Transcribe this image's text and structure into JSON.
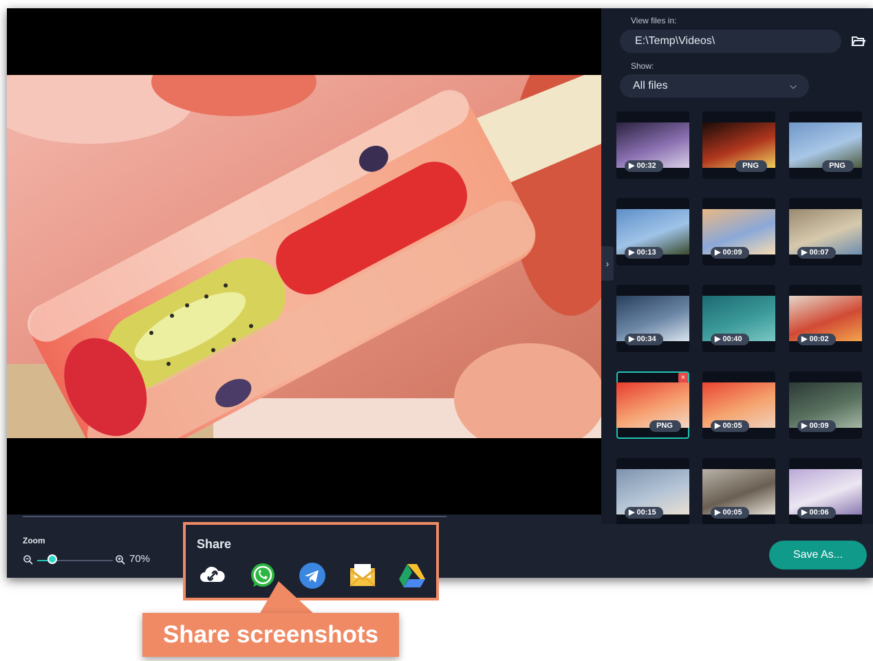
{
  "sidebar": {
    "view_files_label": "View files in:",
    "path_value": "E:\\Temp\\Videos\\",
    "show_label": "Show:",
    "show_selected": "All files",
    "thumbnails": [
      {
        "badge": "▶ 00:32",
        "type": "video"
      },
      {
        "badge": "PNG",
        "type": "image"
      },
      {
        "badge": "PNG",
        "type": "image"
      },
      {
        "badge": "▶ 00:13",
        "type": "video"
      },
      {
        "badge": "▶ 00:09",
        "type": "video"
      },
      {
        "badge": "▶ 00:07",
        "type": "video"
      },
      {
        "badge": "▶ 00:34",
        "type": "video"
      },
      {
        "badge": "▶ 00:40",
        "type": "video"
      },
      {
        "badge": "▶ 00:02",
        "type": "video"
      },
      {
        "badge": "PNG",
        "type": "image",
        "selected": true
      },
      {
        "badge": "▶ 00:05",
        "type": "video"
      },
      {
        "badge": "▶ 00:09",
        "type": "video"
      },
      {
        "badge": "▶ 00:15",
        "type": "video"
      },
      {
        "badge": "▶ 00:05",
        "type": "video"
      },
      {
        "badge": "▶ 00:06",
        "type": "video"
      }
    ]
  },
  "bottom": {
    "zoom_label": "Zoom",
    "zoom_value": "70%",
    "zoom_fraction": 0.2,
    "save_label": "Save As..."
  },
  "share": {
    "label": "Share",
    "icons": [
      "cloud-link-icon",
      "whatsapp-icon",
      "telegram-icon",
      "email-icon",
      "google-drive-icon"
    ]
  },
  "callout": {
    "text": "Share screenshots"
  },
  "colors": {
    "accent": "#20c4b4",
    "save_button": "#0f9a8a",
    "highlight": "#f08a65",
    "panel": "#1c2230",
    "sidebar": "#161c2a"
  }
}
